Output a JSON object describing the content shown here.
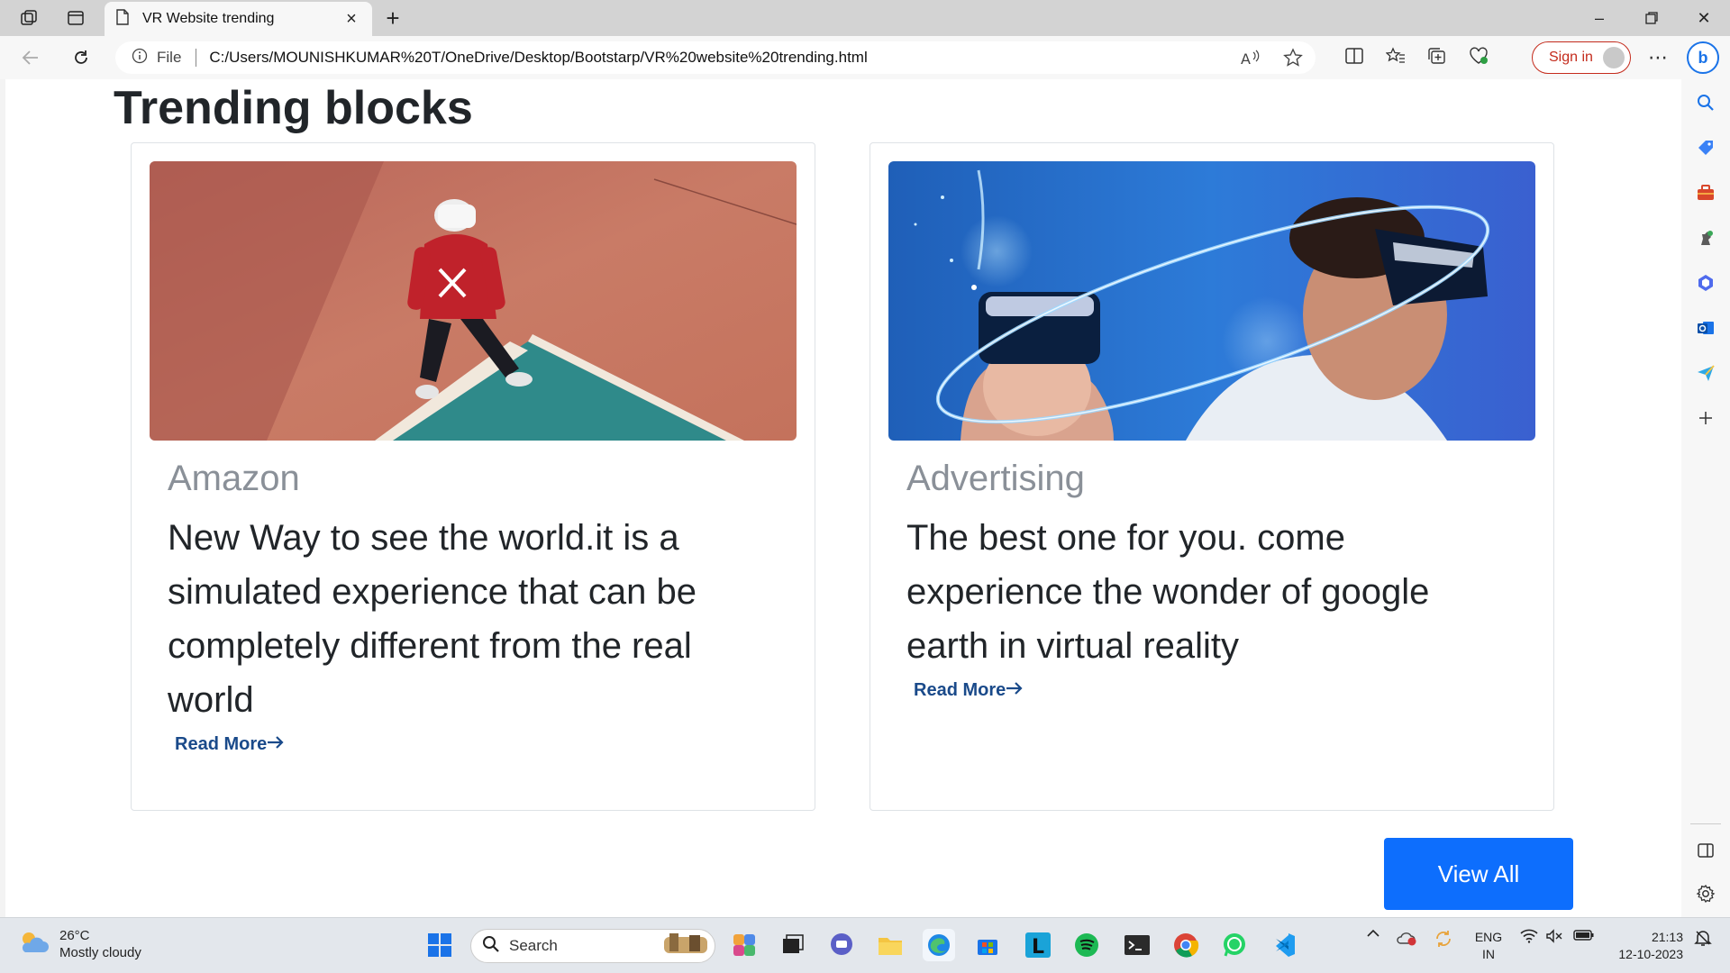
{
  "browser": {
    "tab_title": "VR Website trending",
    "address_prefix": "File",
    "address_url": "C:/Users/MOUNISHKUMAR%20T/OneDrive/Desktop/Bootstarp/VR%20website%20trending.html",
    "signin_label": "Sign in"
  },
  "page": {
    "heading": "Trending blocks",
    "cards": [
      {
        "title": "Amazon",
        "text": "New Way to see the world.it is a simulated experience that can be completely different from the real world",
        "link": "Read More"
      },
      {
        "title": "Advertising",
        "text": "The best one for you. come experience the wonder of google earth in virtual reality",
        "link": "Read More"
      }
    ],
    "view_all_label": "View All"
  },
  "taskbar": {
    "weather_temp": "26°C",
    "weather_desc": "Mostly cloudy",
    "search_placeholder": "Search",
    "lang_top": "ENG",
    "lang_bottom": "IN",
    "time": "21:13",
    "date": "12-10-2023"
  },
  "colors": {
    "primary_button": "#0d6efd",
    "link": "#1a4a8a",
    "card_title": "#8a9098",
    "signin": "#c42b1c"
  }
}
